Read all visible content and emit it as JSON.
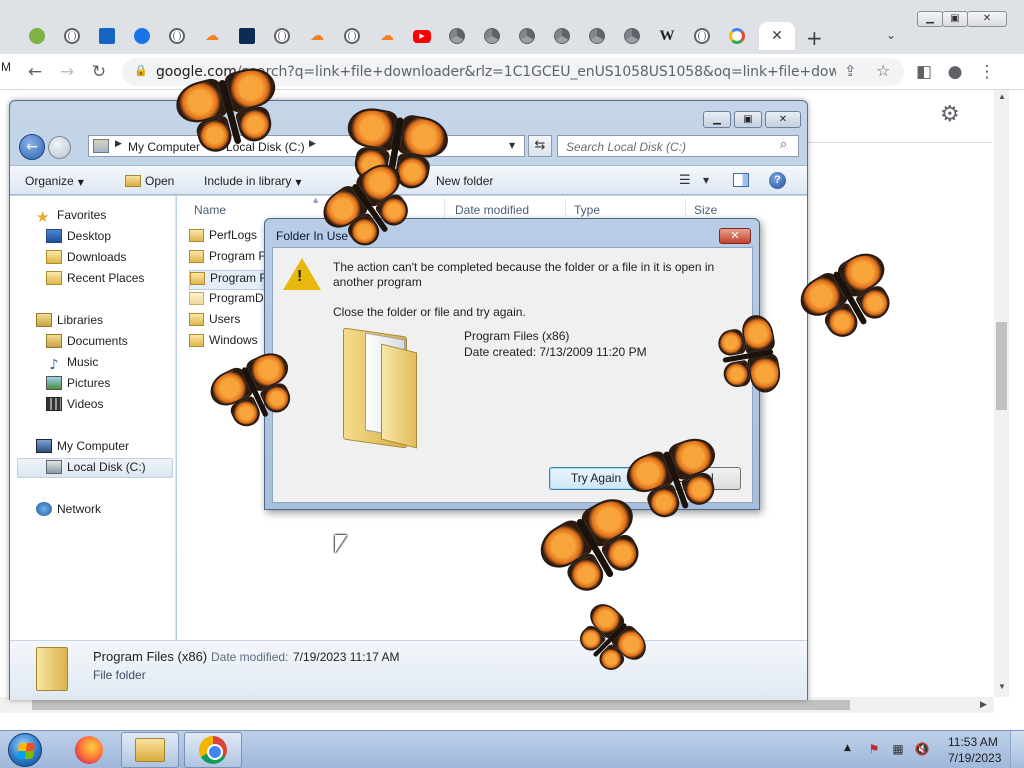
{
  "browser": {
    "url_host": "google.com",
    "url_rest": "/search?q=link+file+downloader&rlz=1C1GCEU_enUS1058US1058&oq=link+file+downloader&...",
    "tab_icons": [
      "frog-icon",
      "globe-icon",
      "chart-icon",
      "gear-icon",
      "globe-icon",
      "cloudflare-icon",
      "square-o-icon",
      "globe-icon",
      "cloudflare-icon",
      "globe-icon",
      "cloudflare-icon",
      "youtube-icon",
      "chrome-icon",
      "chrome-icon",
      "chrome-icon",
      "chrome-icon",
      "chrome-icon",
      "chrome-icon",
      "wikipedia-icon",
      "globe-icon",
      "google-icon"
    ],
    "wiki_glyph": "W",
    "tab_close": "✕",
    "new_tab": "+",
    "side_text": "M"
  },
  "explorer": {
    "breadcrumbs": [
      "My Computer",
      "Local Disk (C:)"
    ],
    "search_placeholder": "Search Local Disk (C:)",
    "commands": {
      "organize": "Organize",
      "open": "Open",
      "include": "Include in library",
      "new_folder": "New folder"
    },
    "nav": {
      "favorites": "Favorites",
      "desktop": "Desktop",
      "downloads": "Downloads",
      "recent": "Recent Places",
      "libraries": "Libraries",
      "documents": "Documents",
      "music": "Music",
      "pictures": "Pictures",
      "videos": "Videos",
      "computer": "My Computer",
      "local_disk": "Local Disk (C:)",
      "network": "Network"
    },
    "columns": {
      "name": "Name",
      "date": "Date modified",
      "type": "Type",
      "size": "Size"
    },
    "files": [
      "PerfLogs",
      "Program Files",
      "Program Files (x86)",
      "ProgramData",
      "Users",
      "Windows"
    ],
    "details": {
      "name": "Program Files (x86)",
      "modified_label": "Date modified:",
      "modified": "7/19/2023 11:17 AM",
      "type": "File folder"
    }
  },
  "dialog": {
    "title": "Folder In Use",
    "message": "The action can't be completed because the folder or a file in it is open in another program",
    "hint": "Close the folder or file and try again.",
    "folder_name": "Program Files (x86)",
    "date_created": "Date created: 7/13/2009 11:20 PM",
    "try_again": "Try Again",
    "cancel": "Cancel"
  },
  "taskbar": {
    "time": "11:53 AM",
    "date": "7/19/2023"
  },
  "colors": {
    "butterfly": "#f0801f",
    "dialog_frame": "#b9cde7",
    "taskbar": "#9fb8da"
  }
}
